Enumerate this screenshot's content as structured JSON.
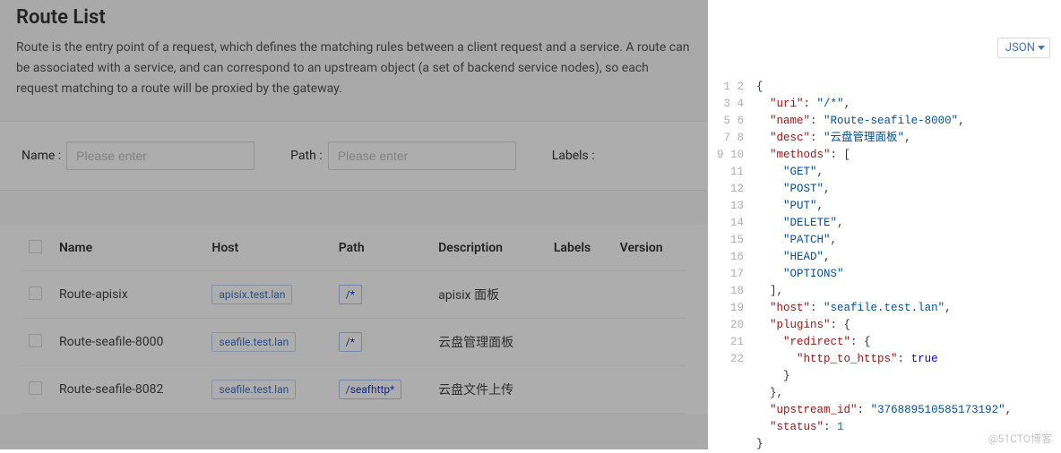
{
  "header": {
    "title": "Route List",
    "description": "Route is the entry point of a request, which defines the matching rules between a client request and a service. A route can be associated with a service, and can correspond to an upstream object (a set of backend service nodes), so each request matching to a route will be proxied by the gateway."
  },
  "filters": {
    "name_label": "Name :",
    "name_placeholder": "Please enter",
    "path_label": "Path :",
    "path_placeholder": "Please enter",
    "labels_label": "Labels :"
  },
  "table": {
    "columns": {
      "name": "Name",
      "host": "Host",
      "path": "Path",
      "description": "Description",
      "labels": "Labels",
      "version": "Version"
    },
    "rows": [
      {
        "name": "Route-apisix",
        "host": "apisix.test.lan",
        "path": "/*",
        "description": "apisix 面板",
        "labels": "",
        "version": ""
      },
      {
        "name": "Route-seafile-8000",
        "host": "seafile.test.lan",
        "path": "/*",
        "description": "云盘管理面板",
        "labels": "",
        "version": ""
      },
      {
        "name": "Route-seafile-8082",
        "host": "seafile.test.lan",
        "path": "/seafhttp*",
        "description": "云盘文件上传",
        "labels": "",
        "version": ""
      }
    ]
  },
  "side_panel": {
    "format_selector": "JSON",
    "json": {
      "uri": "/*",
      "name": "Route-seafile-8000",
      "desc": "云盘管理面板",
      "methods": [
        "GET",
        "POST",
        "PUT",
        "DELETE",
        "PATCH",
        "HEAD",
        "OPTIONS"
      ],
      "host": "seafile.test.lan",
      "plugins": {
        "redirect": {
          "http_to_https": true
        }
      },
      "upstream_id": "376889510585173192",
      "status": 1
    },
    "line_count": 22
  },
  "watermark": "@51CTO博客"
}
